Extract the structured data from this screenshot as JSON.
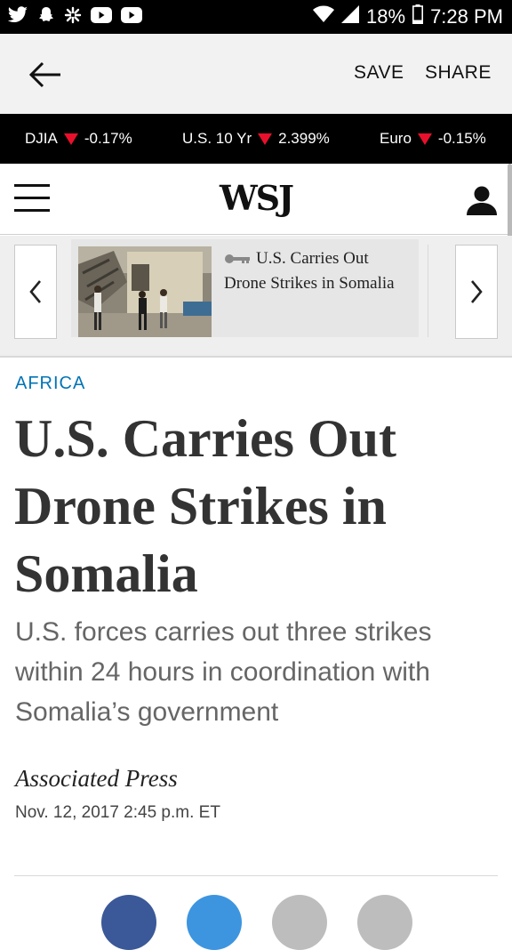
{
  "status_bar": {
    "battery": "18%",
    "time": "7:28 PM",
    "icons": [
      "twitter-icon",
      "snapchat-icon",
      "pinwheel-icon",
      "youtube-icon",
      "youtube-icon",
      "wifi-icon",
      "signal-icon",
      "battery-icon"
    ]
  },
  "toolbar": {
    "save_label": "SAVE",
    "share_label": "SHARE"
  },
  "ticker": {
    "items": [
      {
        "name": "DJIA",
        "change": "-0.17%"
      },
      {
        "name": "U.S. 10 Yr",
        "change": "2.399%"
      },
      {
        "name": "Euro",
        "change": "-0.15%"
      }
    ],
    "down_color": "#e8102c"
  },
  "header": {
    "logo": "WSJ"
  },
  "carousel": {
    "card_title": "U.S. Carries Out Drone Strikes in Somalia",
    "card_icon": "key-icon"
  },
  "article": {
    "section": "AFRICA",
    "headline": "U.S. Carries Out Drone Strikes in Somalia",
    "dek": "U.S. forces carries out three strikes within 24 hours in coordination with Somalia’s government",
    "byline": "Associated Press",
    "timestamp": "Nov. 12, 2017 2:45 p.m. ET"
  },
  "colors": {
    "section_accent": "#0274b6",
    "ticker_bg": "#000000",
    "toolbar_bg": "#f2f2f2"
  }
}
